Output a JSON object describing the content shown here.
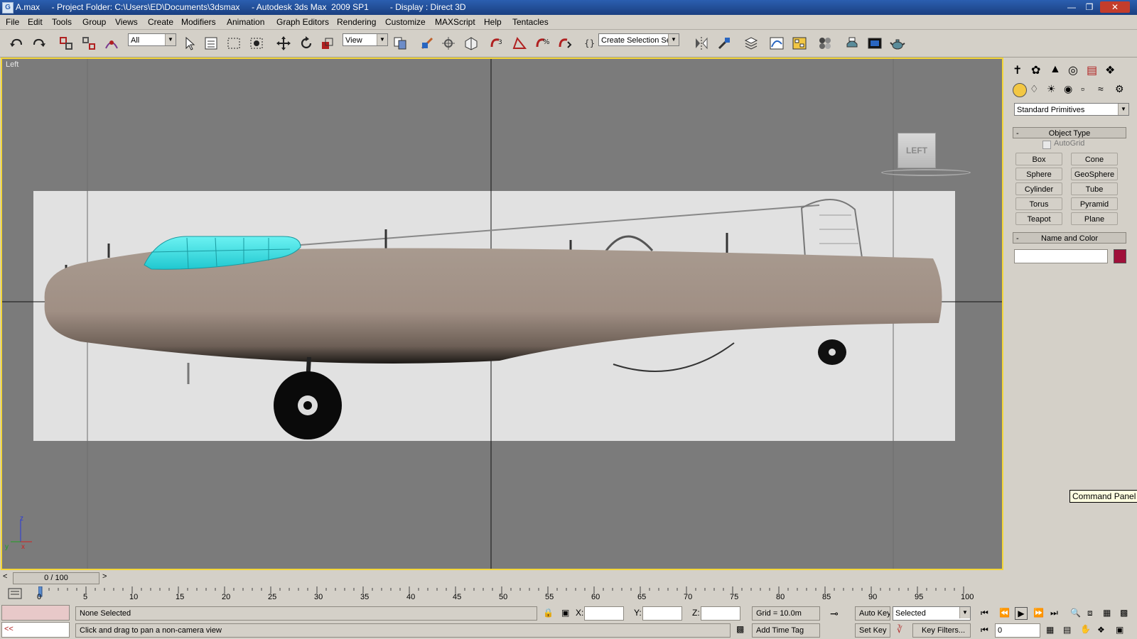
{
  "window": {
    "title": "A.max     - Project Folder: C:\\Users\\ED\\Documents\\3dsmax     - Autodesk 3ds Max  2009 SP1         - Display : Direct 3D",
    "app_icon": "3dsmax-logo-icon"
  },
  "menu": [
    "File",
    "Edit",
    "Tools",
    "Group",
    "Views",
    "Create",
    "Modifiers",
    "Animation",
    "Graph Editors",
    "Rendering",
    "Customize",
    "MAXScript",
    "Help",
    "Tentacles"
  ],
  "toolbar": {
    "selection_filter": "All",
    "reference_coord": "View",
    "selection_set_placeholder": "Create Selection Set"
  },
  "viewport": {
    "label": "Left",
    "viewcube_label": "LEFT",
    "axis_z": "z",
    "axis_y": "y",
    "axis_x": "x"
  },
  "command_panel": {
    "category": "Standard Primitives",
    "object_type_title": "Object Type",
    "autogrid_label": "AutoGrid",
    "primitives": [
      "Box",
      "Cone",
      "Sphere",
      "GeoSphere",
      "Cylinder",
      "Tube",
      "Torus",
      "Pyramid",
      "Teapot",
      "Plane"
    ],
    "name_color_title": "Name and Color",
    "object_color": "#a0103a"
  },
  "tooltip": "Command Panel",
  "timeline": {
    "slider_label": "0 / 100",
    "ticks": [
      "0",
      "5",
      "10",
      "15",
      "20",
      "25",
      "30",
      "35",
      "40",
      "45",
      "50",
      "55",
      "60",
      "65",
      "70",
      "75",
      "80",
      "85",
      "90",
      "95",
      "100"
    ]
  },
  "status": {
    "selection": "None Selected",
    "prompt": "Click and drag to pan a non-camera view",
    "maxscript_prompt": "<<",
    "x_label": "X:",
    "y_label": "Y:",
    "z_label": "Z:",
    "grid": "Grid = 10.0m",
    "add_time_tag": "Add Time Tag",
    "auto_key": "Auto Key",
    "set_key": "Set Key",
    "key_mode": "Selected",
    "key_filters": "Key Filters...",
    "current_frame": "0"
  },
  "colors": {
    "viewport_bg": "#7b7b7b",
    "viewport_border": "#f4d637",
    "fuselage": "#a89a8f",
    "canopy": "#3ce8e8"
  }
}
